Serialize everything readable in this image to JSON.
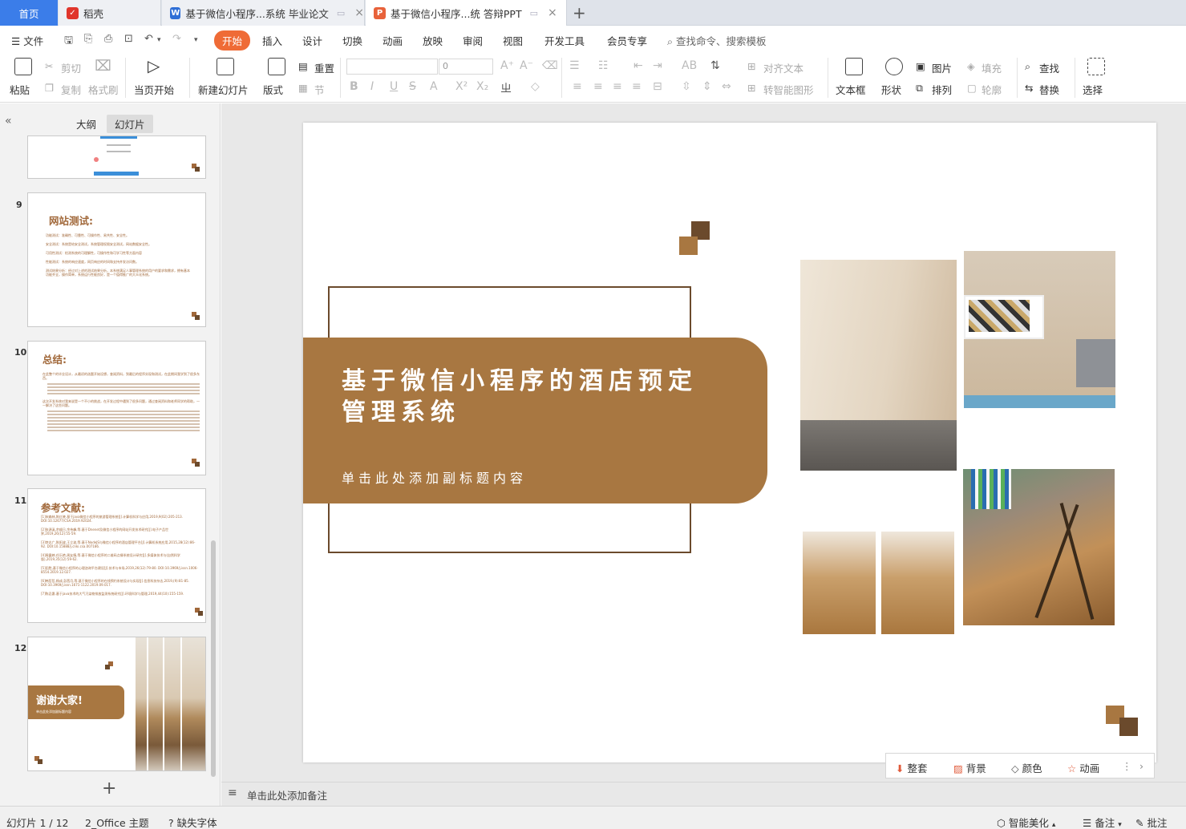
{
  "tabs": {
    "home": "首页",
    "daoke": "稻壳",
    "doc1": "基于微信小程序...系统 毕业论文",
    "doc2": "基于微信小程序...统 答辩PPT"
  },
  "menu": {
    "file": "文件",
    "items": [
      "开始",
      "插入",
      "设计",
      "切换",
      "动画",
      "放映",
      "审阅",
      "视图",
      "开发工具",
      "会员专享"
    ],
    "search": "查找命令、搜索模板"
  },
  "ribbon": {
    "paste": "粘贴",
    "cut": "剪切",
    "copy": "复制",
    "format_painter": "格式刷",
    "from_current": "当页开始",
    "new_slide": "新建幻灯片",
    "layout": "版式",
    "reset": "重置",
    "section": "节",
    "font_size_value": "0",
    "align_text": "对齐文本",
    "smart_art": "转智能图形",
    "textbox": "文本框",
    "shape": "形状",
    "picture": "图片",
    "arrange": "排列",
    "fill": "填充",
    "outline": "轮廓",
    "find": "查找",
    "replace": "替换",
    "select": "选择"
  },
  "leftpane": {
    "tab_outline": "大纲",
    "tab_slides": "幻灯片",
    "slides": [
      {
        "num": "9",
        "title": "网站测试:",
        "bullets": [
          "功能测试：准确性、可靠性、可操作性、易共性、安全性。",
          "安全测试：系统是给安全测试，系统管理权限安全测试，网站数据安全性。",
          "可用性测试：检测系统的可理解性，可操作性和可学习性等方面内容",
          "性能测试：系统的响应速度，网页响应的时间和支持并发访问数。",
          "测试结果分析：经过对上述的测试结果分析，本系统满足人事管理系统的用户的要求和需求，拥有基本功能齐全，操作简单，系统运行性能良好，是一个值得推广的大众化系统。"
        ]
      },
      {
        "num": "10",
        "title": "总结:",
        "bullets": [
          "在此整个的毕业设计，从最初的选题开始设想，查阅资料，到最后的程序实现和测试，在此期间我学到了很多东西。",
          "这次开发系统对我来说是一个不小的挑战，在开发过程中遇到了很多问题，通过查阅资料和老师同学的帮助，一一解决了这些问题。"
        ]
      },
      {
        "num": "11",
        "title": "参考文献:",
        "bullets": [
          "[1]宋森林,陈红晓.基于java微信小程序的旅游管理系统[J].计算机科学与应用,2019,9(02):205-213. DOI:10.12677/CSA.2019.92024.",
          "[2]张源溪,余顺日,余伟峰,等.基于Dnenet及微信小程序的网站开发技术研究[J].电子产品世界,2019,26(12):55-59.",
          "[3]李志广,陈阳波,王立波,等.基于NodeJS与微信小程序的酒店管理平台[J].计算机系统应用,2015,28(12):86-92. DOI:10.15888/j.cnki.csa.007186.",
          "[4]周露婷,任乐艳,周友情,等.基于微信小程序的二维码点餐系统设计研究[J].多媒体技术与(自然科学版),2019,35(12):59-62.",
          "[5]田胜,基于微信小程序的心理咨询平台建设[J].技术与市场,2019,26(12):79-80. DOI:10.3969/j.issn.1006-8554.2019.12.027.",
          "[6]韩哲哲,杨成,彭茜月,等.基于微信小程序的在线预约系统设计与实现[J].信息科技杂志,2019,(9):81-85. DOI:10.3969/j.issn.1671-1122.2019.09.017.",
          "[7]陈忌惠.基于java技术的大气污染物排放监测系统研究[J].环境科学与管理,2019,44(10):155-159."
        ]
      },
      {
        "num": "12",
        "title": "谢谢大家!",
        "subtitle": "单击此处添加副标题内容"
      }
    ]
  },
  "slide": {
    "title": "基于微信小程序的酒店预定管理系统",
    "subtitle": "单击此处添加副标题内容",
    "colors": {
      "accent": "#a87741",
      "dark": "#6b4a2c"
    }
  },
  "floatbar": {
    "set": "整套",
    "background": "背景",
    "color": "颜色",
    "animation": "动画"
  },
  "notes_placeholder": "单击此处添加备注",
  "status": {
    "slide_index": "幻灯片 1 / 12",
    "theme": "2_Office 主题",
    "missing_font": "缺失字体",
    "beautify": "智能美化",
    "notes": "备注",
    "comments": "批注"
  }
}
